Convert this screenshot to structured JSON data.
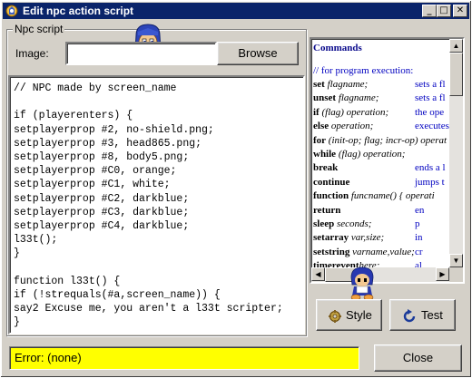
{
  "window": {
    "title": "Edit npc action script",
    "controls": {
      "minimize": "_",
      "maximize": "□",
      "close": "✕"
    }
  },
  "group": {
    "legend": "Npc script"
  },
  "image": {
    "label": "Image:",
    "value": "",
    "browse_label": "Browse"
  },
  "script": {
    "lines": [
      "// NPC made by screen_name",
      "",
      "if (playerenters) {",
      "setplayerprop #2, no-shield.png;",
      "setplayerprop #3, head865.png;",
      "setplayerprop #8, body5.png;",
      "setplayerprop #C0, orange;",
      "setplayerprop #C1, white;",
      "setplayerprop #C2, darkblue;",
      "setplayerprop #C3, darkblue;",
      "setplayerprop #C4, darkblue;",
      "l33t();",
      "}",
      "",
      "function l33t() {",
      "if (!strequals(#a,screen_name)) {",
      "say2 Excuse me, you aren't a l33t scripter;",
      "}"
    ]
  },
  "help": {
    "title": "Commands",
    "comment": "// for program execution:",
    "rows": [
      {
        "kw": "set",
        "args": " flagname;",
        "desc": "sets a fl"
      },
      {
        "kw": "unset",
        "args": " flagname;",
        "desc": "sets a fl"
      },
      {
        "kw": "if",
        "args": " (flag) operation;",
        "desc": "the ope"
      },
      {
        "kw": "else",
        "args": " operation;",
        "desc": "executes"
      },
      {
        "kw": "for",
        "args": " (init-op; flag; incr-op) operat",
        "desc": ""
      },
      {
        "kw": "while",
        "args": " (flag) operation;",
        "desc": ""
      },
      {
        "kw": "break",
        "args": "",
        "desc": "ends a l"
      },
      {
        "kw": "continue",
        "args": "",
        "desc": "jumps t"
      },
      {
        "kw": "function",
        "args": " funcname() { operati",
        "desc": ""
      },
      {
        "kw": "return",
        "args": "",
        "desc": "en"
      },
      {
        "kw": "sleep",
        "args": " seconds;",
        "desc": "p"
      },
      {
        "kw": "setarray",
        "args": " var,size;",
        "desc": "in"
      },
      {
        "kw": "setstring",
        "args": " varname,value;",
        "desc": "cr"
      },
      {
        "kw": "timerevent",
        "args": "here;",
        "desc": "al"
      }
    ]
  },
  "buttons": {
    "style": "Style",
    "test": "Test",
    "close": "Close"
  },
  "status": {
    "text": "Error: (none)"
  },
  "colors": {
    "titlebar": "#0a246a",
    "status_bg": "#ffff00",
    "face": "#d4d0c8",
    "help_text": "#0000c0"
  }
}
